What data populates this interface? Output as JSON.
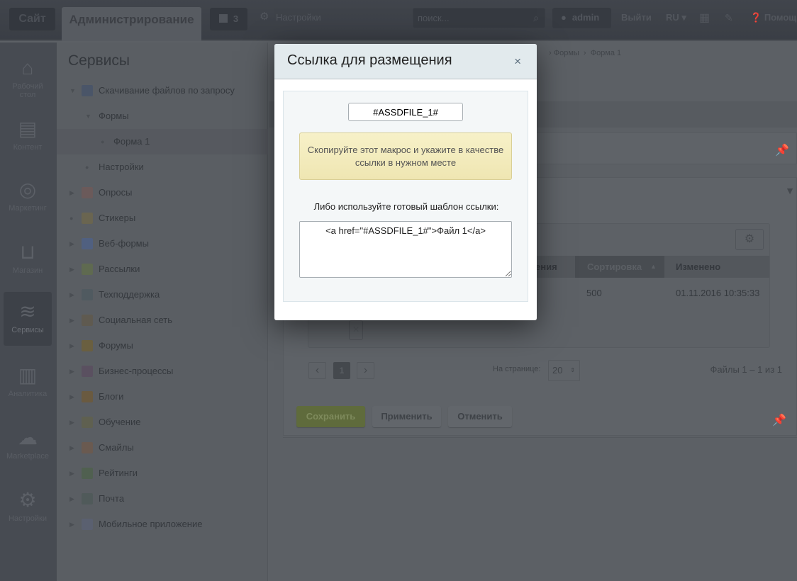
{
  "topbar": {
    "site": "Сайт",
    "admin": "Администрирование",
    "notifications": "3",
    "settings": "Настройки",
    "search_placeholder": "поиск...",
    "user": "admin",
    "logout": "Выйти",
    "lang": "RU",
    "help": "Помощь"
  },
  "leftnav": [
    {
      "label": "Рабочий стол",
      "icon": "home-icon",
      "glyph": "⌂"
    },
    {
      "label": "Контент",
      "icon": "document-icon",
      "glyph": "▤"
    },
    {
      "label": "Маркетинг",
      "icon": "target-icon",
      "glyph": "◎"
    },
    {
      "label": "Магазин",
      "icon": "basket-icon",
      "glyph": "⊔"
    },
    {
      "label": "Сервисы",
      "icon": "layers-icon",
      "glyph": "≋",
      "selected": true
    },
    {
      "label": "Аналитика",
      "icon": "bar-chart-icon",
      "glyph": "▥"
    },
    {
      "label": "Marketplace",
      "icon": "cloud-download-icon",
      "glyph": "☁"
    },
    {
      "label": "Настройки",
      "icon": "gear-icon",
      "glyph": "⚙"
    }
  ],
  "tree": {
    "title": "Сервисы",
    "items": [
      {
        "label": "Скачивание файлов по запросу",
        "level": 0,
        "state": "open"
      },
      {
        "label": "Формы",
        "level": 1,
        "state": "open"
      },
      {
        "label": "Форма 1",
        "level": 2,
        "state": "leaf",
        "selected": true
      },
      {
        "label": "Настройки",
        "level": 1,
        "state": "leaf"
      },
      {
        "label": "Опросы",
        "level": 0,
        "state": "closed"
      },
      {
        "label": "Стикеры",
        "level": 0,
        "state": "leaf"
      },
      {
        "label": "Веб-формы",
        "level": 0,
        "state": "closed"
      },
      {
        "label": "Рассылки",
        "level": 0,
        "state": "closed"
      },
      {
        "label": "Техподдержка",
        "level": 0,
        "state": "closed"
      },
      {
        "label": "Социальная сеть",
        "level": 0,
        "state": "closed"
      },
      {
        "label": "Форумы",
        "level": 0,
        "state": "closed"
      },
      {
        "label": "Бизнес-процессы",
        "level": 0,
        "state": "closed"
      },
      {
        "label": "Блоги",
        "level": 0,
        "state": "closed"
      },
      {
        "label": "Обучение",
        "level": 0,
        "state": "closed"
      },
      {
        "label": "Смайлы",
        "level": 0,
        "state": "closed"
      },
      {
        "label": "Рейтинги",
        "level": 0,
        "state": "closed"
      },
      {
        "label": "Почта",
        "level": 0,
        "state": "closed"
      },
      {
        "label": "Мобильное приложение",
        "level": 0,
        "state": "closed"
      }
    ]
  },
  "main": {
    "breadcrumb": [
      "Формы",
      "Форма 1"
    ],
    "table": {
      "columns": [
        "ения",
        "Сортировка",
        "Изменено"
      ],
      "sorted_column": "Сортировка",
      "rows": [
        {
          "sort": "500",
          "modified": "01.11.2016 10:35:33"
        }
      ]
    },
    "pagination": {
      "current": "1",
      "per_page_label": "На странице:",
      "per_page": "20",
      "summary": "Файлы 1 – 1 из 1"
    },
    "buttons": {
      "save": "Сохранить",
      "apply": "Применить",
      "cancel": "Отменить"
    }
  },
  "modal": {
    "title": "Ссылка для размещения",
    "close": "×",
    "macro": "#ASSDFILE_1#",
    "hint": "Скопируйте этот макрос и укажите в качестве ссылки в нужном месте",
    "or_label": "Либо используйте готовый шаблон ссылки:",
    "template": "<a href=\"#ASSDFILE_1#\">Файл 1</a>"
  },
  "colors": {
    "save_button": "#5f6b3c",
    "hint_bg": "#f3ecbf",
    "modal_header": "#e2eaed"
  }
}
